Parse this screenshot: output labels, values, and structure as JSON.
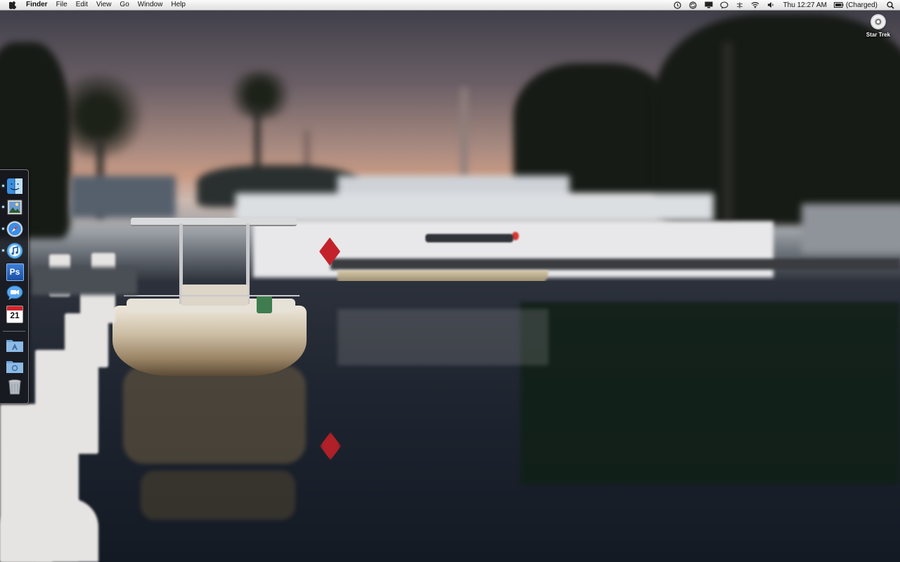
{
  "menubar": {
    "app_name": "Finder",
    "menus": [
      "File",
      "Edit",
      "View",
      "Go",
      "Window",
      "Help"
    ],
    "clock": "Thu 12:27 AM",
    "battery_status": "(Charged)",
    "status_icons": [
      "time-machine-icon",
      "sync-icon",
      "display-icon",
      "chat-status-icon",
      "bluetooth-icon",
      "wifi-icon",
      "volume-icon"
    ]
  },
  "desktop": {
    "disc_label": "Star Trek"
  },
  "dock": {
    "items": [
      {
        "name": "finder",
        "running": true
      },
      {
        "name": "preview",
        "running": true
      },
      {
        "name": "safari",
        "running": true
      },
      {
        "name": "itunes",
        "running": true
      },
      {
        "name": "photoshop",
        "running": false,
        "label": "Ps"
      },
      {
        "name": "ichat",
        "running": false
      },
      {
        "name": "ical",
        "running": false,
        "label": "21"
      },
      {
        "name": "applications-folder",
        "running": false
      },
      {
        "name": "documents-folder",
        "running": false
      },
      {
        "name": "trash",
        "running": false
      }
    ]
  },
  "colors": {
    "menubar": "#e9e9e9",
    "dock_bg": "#16181e",
    "accent_blue": "#3b8ee6"
  }
}
